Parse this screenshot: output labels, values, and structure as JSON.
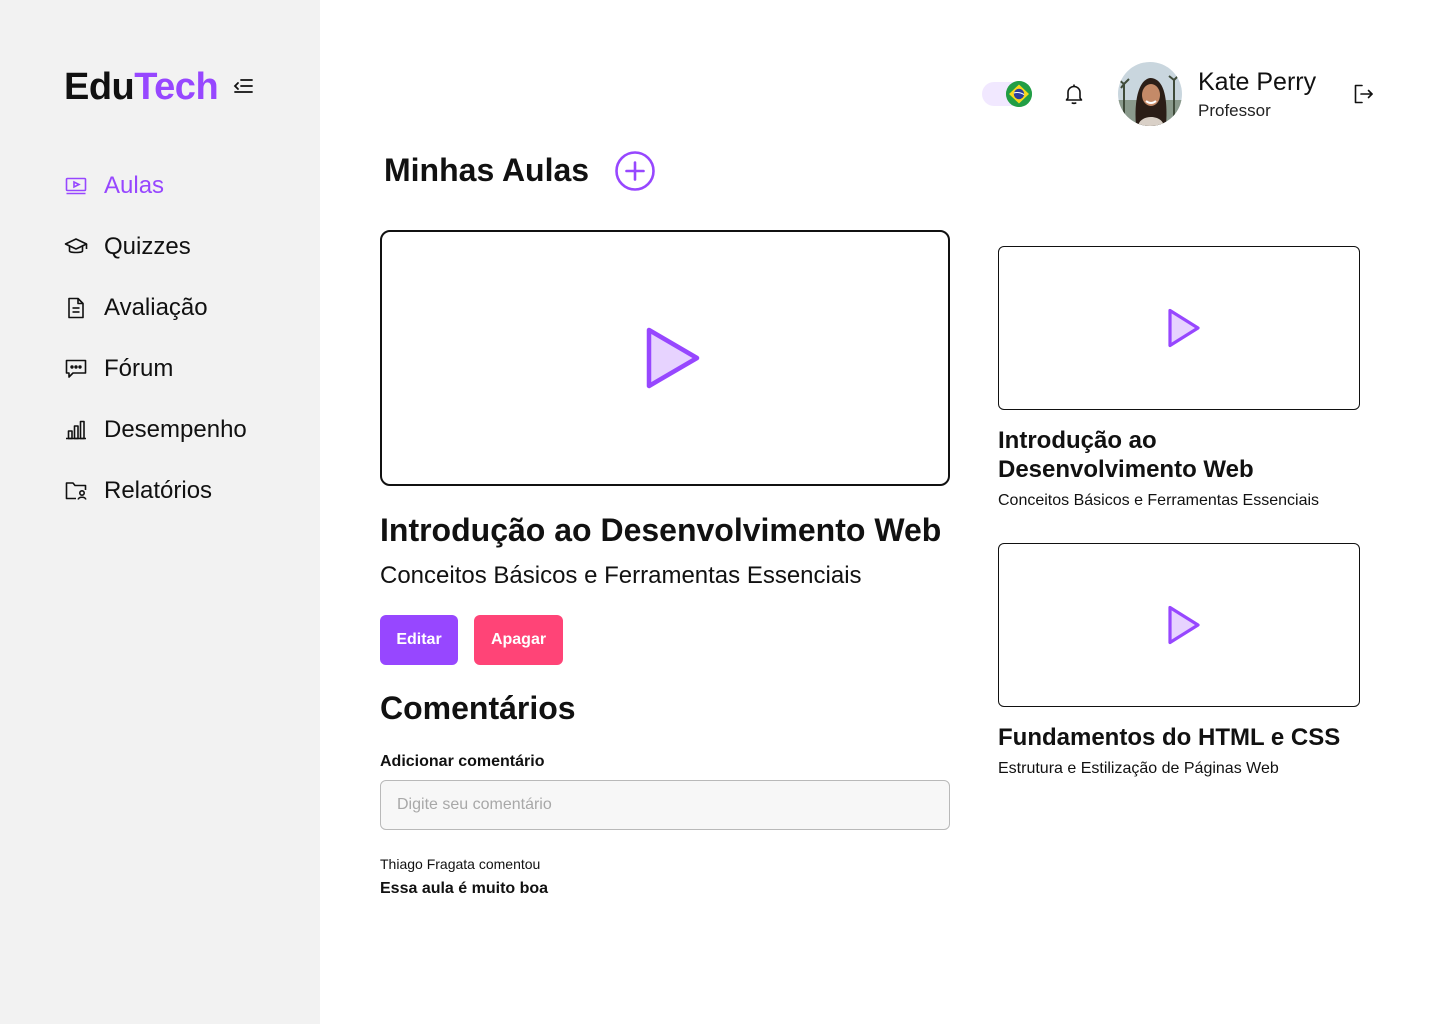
{
  "app": {
    "logo_part1": "Edu",
    "logo_part2": "Tech"
  },
  "sidebar": {
    "items": [
      {
        "label": "Aulas",
        "icon": "video-lesson-icon",
        "active": true
      },
      {
        "label": "Quizzes",
        "icon": "graduation-cap-icon"
      },
      {
        "label": "Avaliação",
        "icon": "document-icon"
      },
      {
        "label": "Fórum",
        "icon": "chat-icon"
      },
      {
        "label": "Desempenho",
        "icon": "bar-chart-icon"
      },
      {
        "label": "Relatórios",
        "icon": "folder-user-icon"
      }
    ]
  },
  "header": {
    "language_flag": "brazil-flag-icon",
    "user": {
      "name": "Kate Perry",
      "role": "Professor"
    }
  },
  "main": {
    "title": "Minhas Aulas",
    "featured": {
      "title": "Introdução ao Desenvolvimento Web",
      "subtitle": "Conceitos Básicos e Ferramentas Essenciais",
      "edit_label": "Editar",
      "delete_label": "Apagar"
    },
    "comments": {
      "title": "Comentários",
      "add_label": "Adicionar comentário",
      "placeholder": "Digite seu comentário",
      "items": [
        {
          "author_line": "Thiago Fragata comentou",
          "text": "Essa aula é muito boa"
        }
      ]
    },
    "lessons": [
      {
        "title_line1": "Introdução ao",
        "title_line2": "Desenvolvimento Web",
        "subtitle": "Conceitos Básicos e Ferramentas Essenciais"
      },
      {
        "title_line1": "Fundamentos do HTML e CSS",
        "title_line2": "",
        "subtitle": "Estrutura e Estilização de Páginas Web"
      }
    ]
  },
  "colors": {
    "accent": "#9747ff",
    "danger": "#ff4477",
    "sidebar_bg": "#f2f2f2"
  }
}
